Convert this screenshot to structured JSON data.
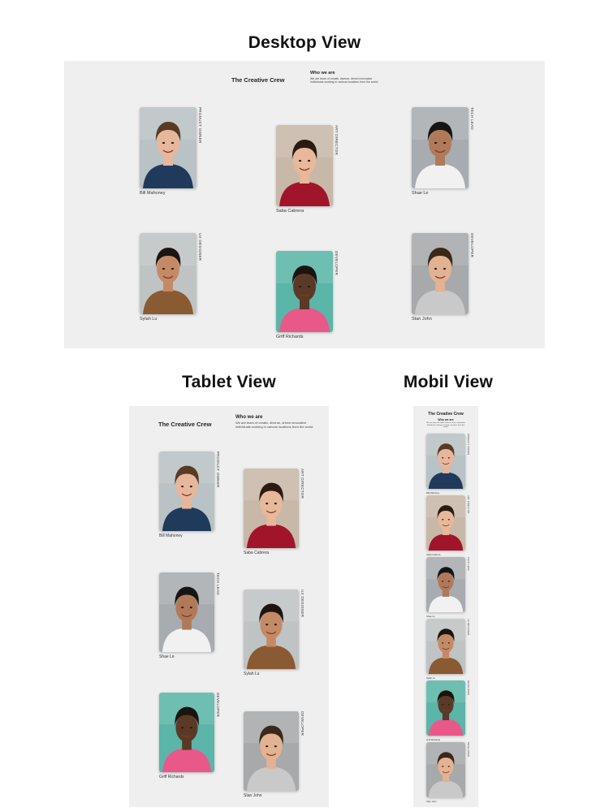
{
  "sections": {
    "desktop_title": "Desktop View",
    "tablet_title": "Tablet View",
    "mobile_title": "Mobil View"
  },
  "site": {
    "brand": "The Creative Crew",
    "who_title": "Who we are",
    "who_text": "We are team of creativ, diverse, driven innovative individuals working in various locations from the world."
  },
  "members": [
    {
      "name": "Bill Mahoney",
      "role": "PRODUCT OWNER",
      "colors": {
        "bg": "#b9c2c4",
        "shirt": "#203a5c",
        "hair": "#5a3a22",
        "skin": "#e6b79c"
      }
    },
    {
      "name": "Saba Cabrera",
      "role": "ART DIRECTOR",
      "colors": {
        "bg": "#c8b8a8",
        "shirt": "#a0152a",
        "hair": "#2a1a12",
        "skin": "#e8b89a"
      }
    },
    {
      "name": "Shae Le",
      "role": "TECH LEAD",
      "colors": {
        "bg": "#a8acb0",
        "shirt": "#f1f1f1",
        "hair": "#151515",
        "skin": "#b07a58"
      }
    },
    {
      "name": "Sylah Lu",
      "role": "UX DESIGNER",
      "colors": {
        "bg": "#bfc3c3",
        "shirt": "#8a5a32",
        "hair": "#1c1410",
        "skin": "#c48a66"
      }
    },
    {
      "name": "Griff Richards",
      "role": "DEVELOPER",
      "colors": {
        "bg": "#5bb5a8",
        "shirt": "#e8598a",
        "hair": "#1a1410",
        "skin": "#5a3a26"
      }
    },
    {
      "name": "Stan John",
      "role": "DEVELOPER",
      "colors": {
        "bg": "#a7a9ab",
        "shirt": "#c9c9c9",
        "hair": "#3a2818",
        "skin": "#e2b292"
      }
    }
  ]
}
